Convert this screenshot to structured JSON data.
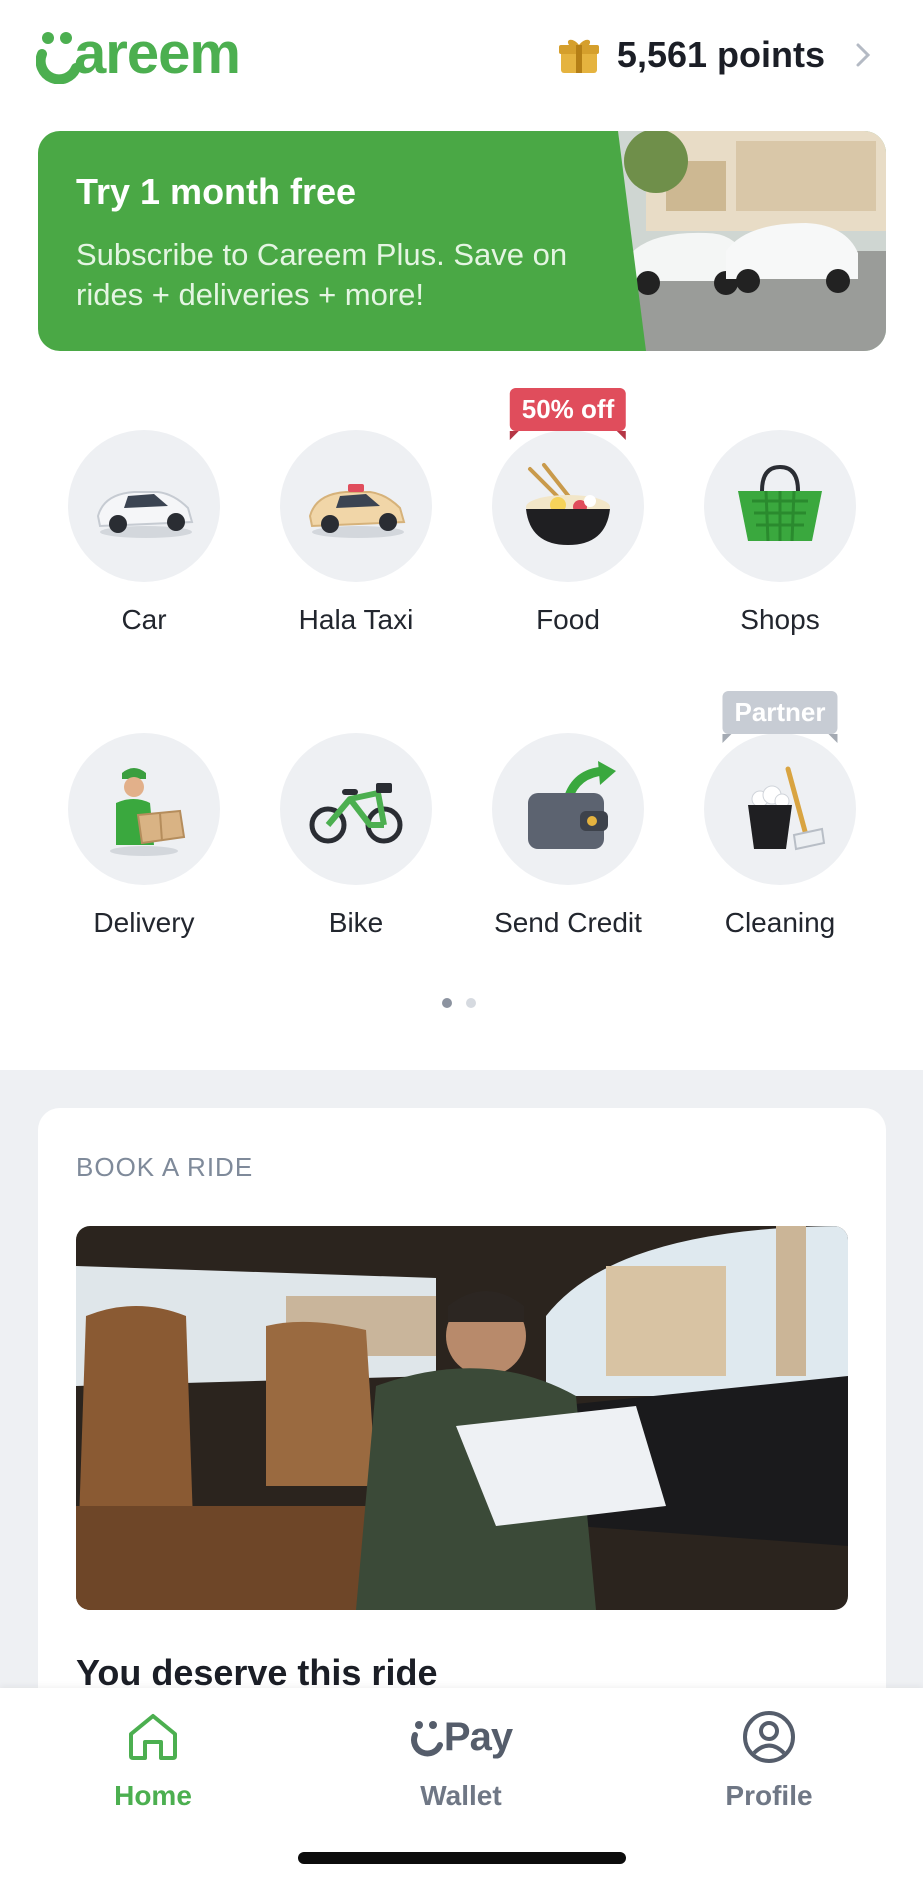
{
  "header": {
    "logo_text": "areem",
    "points_label": "5,561 points"
  },
  "banner": {
    "title": "Try 1 month free",
    "subtitle": "Subscribe to Careem Plus. Save on rides + deliveries + more!"
  },
  "services": [
    {
      "label": "Car",
      "icon": "car-icon",
      "tag": ""
    },
    {
      "label": "Hala Taxi",
      "icon": "taxi-icon",
      "tag": ""
    },
    {
      "label": "Food",
      "icon": "food-bowl-icon",
      "tag": "50% off"
    },
    {
      "label": "Shops",
      "icon": "shopping-basket-icon",
      "tag": ""
    },
    {
      "label": "Delivery",
      "icon": "delivery-person-icon",
      "tag": ""
    },
    {
      "label": "Bike",
      "icon": "bike-icon",
      "tag": ""
    },
    {
      "label": "Send Credit",
      "icon": "wallet-send-icon",
      "tag": ""
    },
    {
      "label": "Cleaning",
      "icon": "cleaning-bucket-icon",
      "tag": "Partner"
    }
  ],
  "pagination": {
    "pages": 2,
    "active": 1
  },
  "book_card": {
    "kicker": "BOOK A RIDE",
    "headline": "You deserve this ride"
  },
  "bottom_nav": {
    "home": "Home",
    "wallet": "Wallet",
    "wallet_brand": "Pay",
    "profile": "Profile"
  },
  "colors": {
    "brand_green": "#4CAF50",
    "banner_green": "#4aa845",
    "tag_red": "#e04d5c",
    "tag_grey": "#c7ccd4"
  }
}
